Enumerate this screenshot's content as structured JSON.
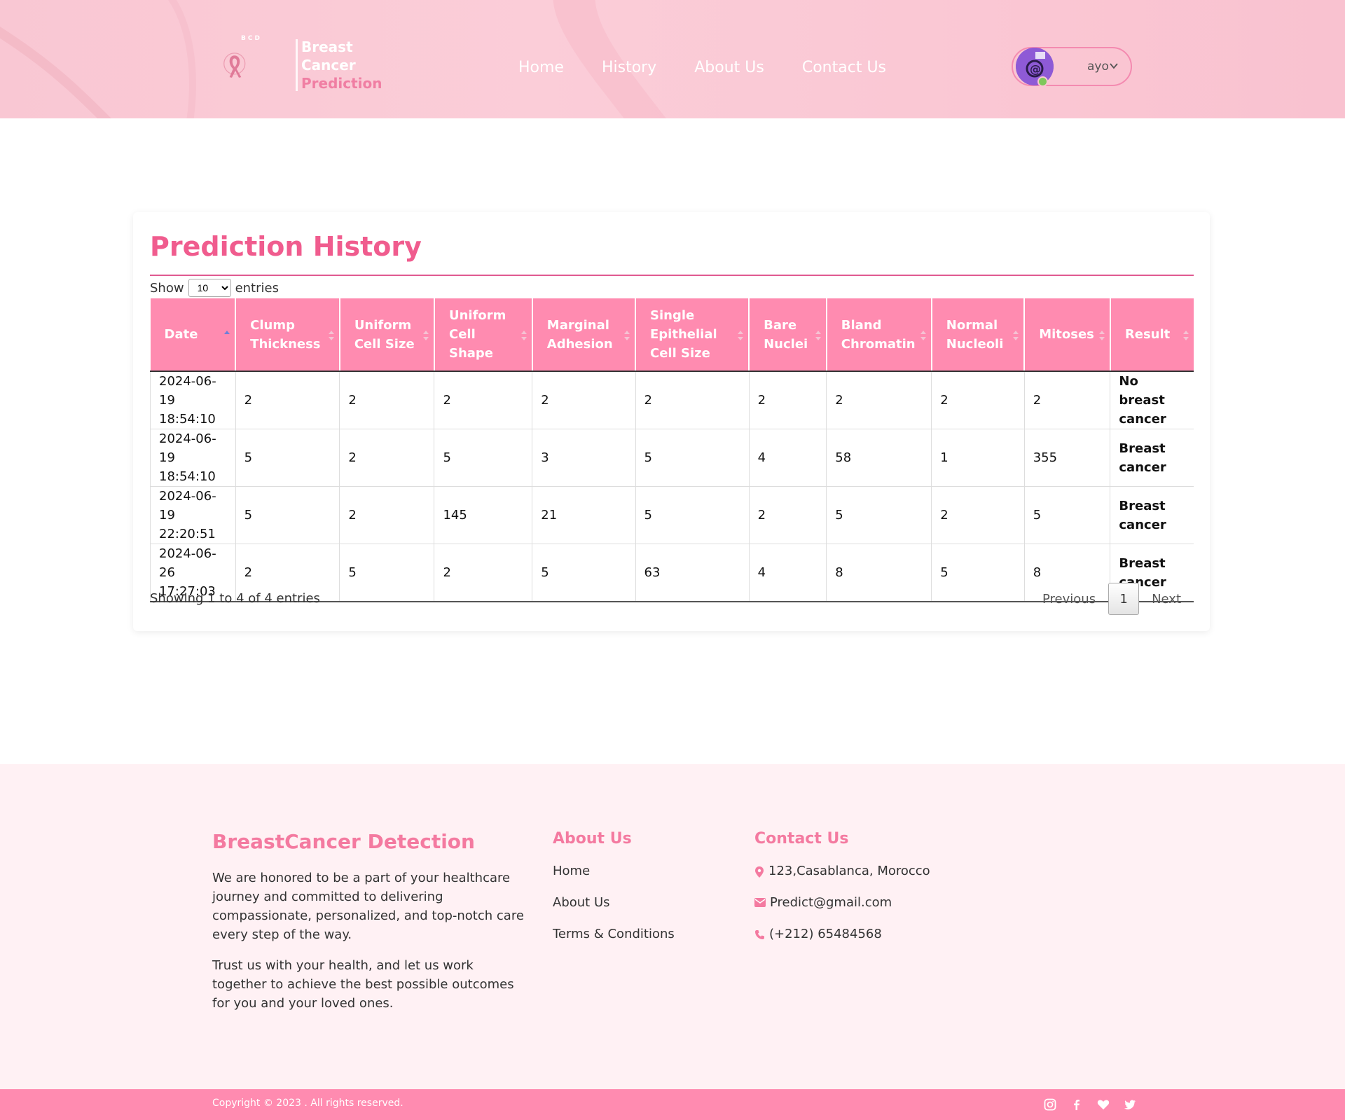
{
  "header": {
    "logo_badge": "BCD",
    "logo_line1": "Breast",
    "logo_line2": "Cancer",
    "logo_line3": "Prediction",
    "nav": [
      "Home",
      "History",
      "About Us",
      "Contact Us"
    ],
    "user_name": "ayo"
  },
  "history": {
    "title": "Prediction History",
    "show_label": "Show",
    "entries_label": "entries",
    "page_size": "10",
    "columns": [
      "Date",
      "Clump Thickness",
      "Uniform Cell Size",
      "Uniform Cell Shape",
      "Marginal Adhesion",
      "Single Epithelial Cell Size",
      "Bare Nuclei",
      "Bland Chromatin",
      "Normal Nucleoli",
      "Mitoses",
      "Result"
    ],
    "rows": [
      [
        "2024-06-19 18:54:10",
        "2",
        "2",
        "2",
        "2",
        "2",
        "2",
        "2",
        "2",
        "2",
        "No breast cancer"
      ],
      [
        "2024-06-19 18:54:10",
        "5",
        "2",
        "5",
        "3",
        "5",
        "4",
        "58",
        "1",
        "355",
        "Breast cancer"
      ],
      [
        "2024-06-19 22:20:51",
        "5",
        "2",
        "145",
        "21",
        "5",
        "2",
        "5",
        "2",
        "5",
        "Breast cancer"
      ],
      [
        "2024-06-26 17:27:03",
        "2",
        "5",
        "2",
        "5",
        "63",
        "4",
        "8",
        "5",
        "8",
        "Breast cancer"
      ]
    ],
    "info": "Showing 1 to 4 of 4 entries",
    "pager": {
      "previous": "Previous",
      "current": "1",
      "next": "Next"
    }
  },
  "footer": {
    "brand": "BreastCancer Detection",
    "desc1": "We are honored to be a part of your healthcare journey and committed to delivering compassionate, personalized, and top-notch care every step of the way.",
    "desc2": "Trust us with your health, and let us work together to achieve the best possible outcomes for you and your loved ones.",
    "about_title": "About Us",
    "about_links": [
      "Home",
      "About Us",
      "Terms & Conditions"
    ],
    "contact_title": "Contact Us",
    "address": "123,Casablanca, Morocco",
    "email": "Predict@gmail.com",
    "phone": "(+212) 65484568",
    "copyright": "Copyright © 2023 . All rights reserved.",
    "socials": [
      "instagram-icon",
      "facebook-icon",
      "heart-icon",
      "twitter-icon"
    ]
  },
  "colors": {
    "accent": "#f05c8e",
    "header_bg": "#f9c7d3",
    "table_head": "#ff8bb0",
    "footer_bg": "#fff1f4"
  }
}
